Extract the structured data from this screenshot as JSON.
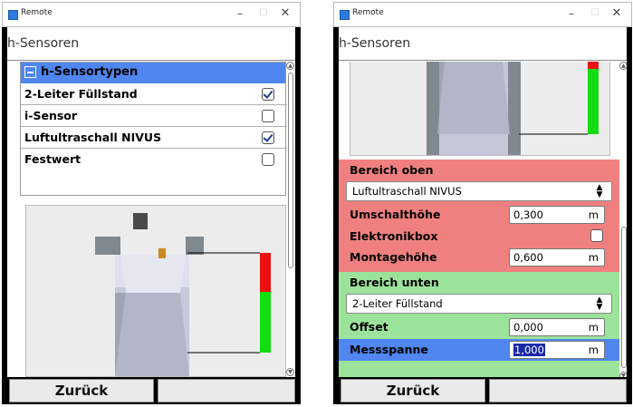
{
  "window": {
    "title": "Remote",
    "min": "–",
    "max": "☐",
    "close": "✕"
  },
  "page_title": "h-Sensoren",
  "left": {
    "group_title": "h-Sensortypen",
    "items": [
      {
        "label": "2-Leiter Füllstand",
        "checked": true
      },
      {
        "label": "i-Sensor",
        "checked": false
      },
      {
        "label": "Luftultraschall NIVUS",
        "checked": true
      },
      {
        "label": "Festwert",
        "checked": false
      }
    ]
  },
  "right": {
    "upper": {
      "title": "Bereich oben",
      "sensor": "Luftultraschall NIVUS",
      "umschalthoehe_label": "Umschalthöhe",
      "umschalthoehe_value": "0,300",
      "umschalthoehe_unit": "m",
      "elektronikbox_label": "Elektronikbox",
      "elektronikbox_checked": false,
      "montagehoehe_label": "Montagehöhe",
      "montagehoehe_value": "0,600",
      "montagehoehe_unit": "m"
    },
    "lower": {
      "title": "Bereich unten",
      "sensor": "2-Leiter Füllstand",
      "offset_label": "Offset",
      "offset_value": "0,000",
      "offset_unit": "m",
      "messspanne_label": "Messspanne",
      "messspanne_value": "1,000",
      "messspanne_unit": "m"
    }
  },
  "footer": {
    "back_label": "Zurück"
  },
  "colors": {
    "accent_blue": "#4f86f0",
    "upper_red": "#f08080",
    "lower_green": "#9be39b",
    "bar_red": "#ee1111",
    "bar_green": "#11dd11"
  }
}
